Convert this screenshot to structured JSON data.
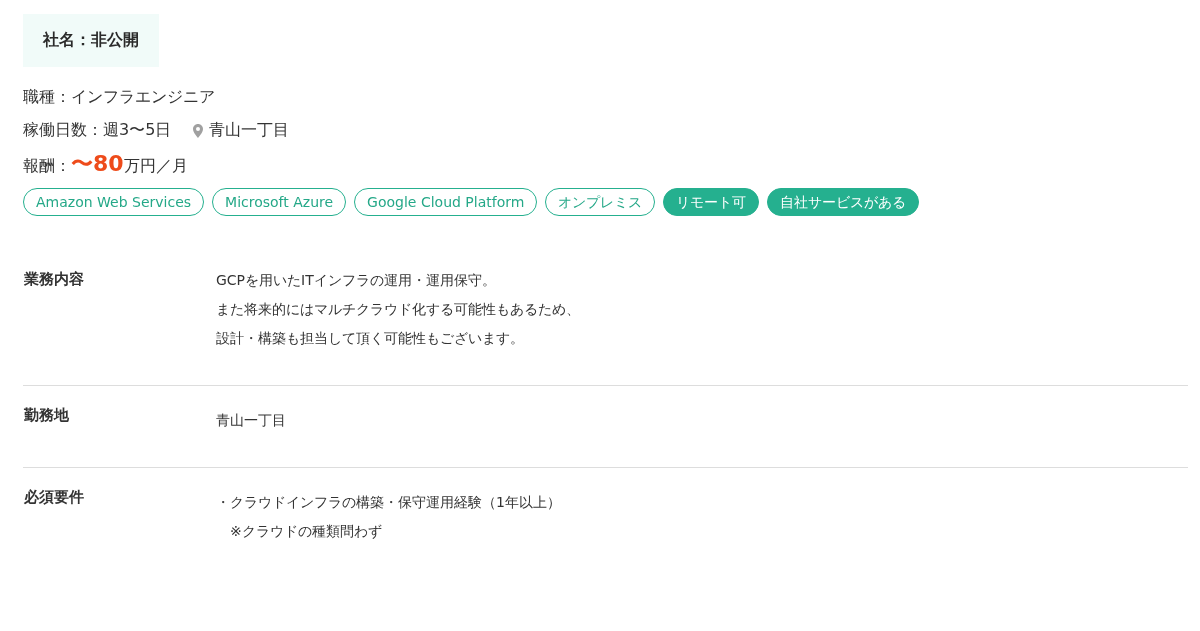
{
  "company": {
    "label": "社名：非公開"
  },
  "job_type": "職種：インフラエンジニア",
  "work_days": "稼働日数：週3〜5日",
  "location": "青山一丁目",
  "salary": {
    "label": "報酬：",
    "amount": "〜80",
    "unit": "万円／月"
  },
  "tags": [
    {
      "label": "Amazon Web Services",
      "kind": "outline"
    },
    {
      "label": "Microsoft Azure",
      "kind": "outline"
    },
    {
      "label": "Google Cloud Platform",
      "kind": "outline"
    },
    {
      "label": "オンプレミス",
      "kind": "outline"
    },
    {
      "label": "リモート可",
      "kind": "filled"
    },
    {
      "label": "自社サービスがある",
      "kind": "filled"
    }
  ],
  "details": [
    {
      "label": "業務内容",
      "lines": [
        "GCPを用いたITインフラの運用・運用保守。",
        "また将来的にはマルチクラウド化する可能性もあるため、",
        "設計・構築も担当して頂く可能性もございます。"
      ]
    },
    {
      "label": "勤務地",
      "lines": [
        "青山一丁目"
      ]
    },
    {
      "label": "必須要件",
      "lines": [
        "・クラウドインフラの構築・保守運用経験（1年以上）",
        "　※クラウドの種類問わず"
      ]
    }
  ]
}
